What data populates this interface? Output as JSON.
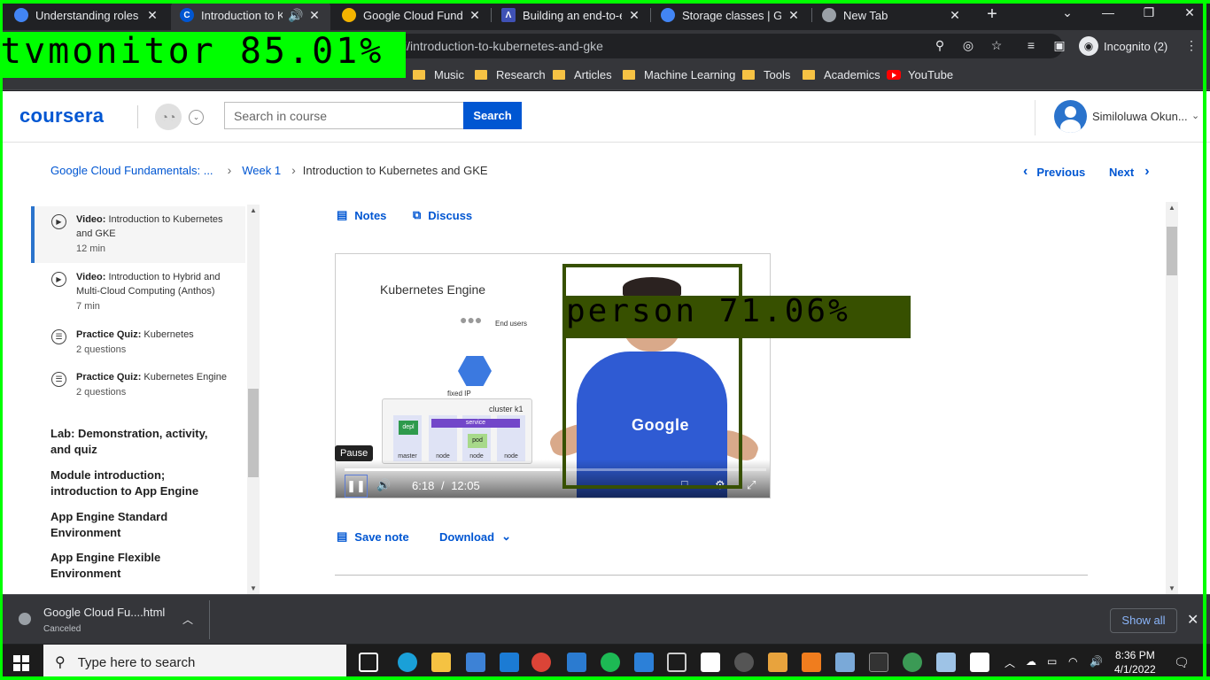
{
  "browser": {
    "tabs": [
      {
        "title": "Understanding roles",
        "favicon_color": "#4285f4",
        "active": false
      },
      {
        "title": "Introduction to Ku",
        "favicon_color": "#0056d2",
        "active": true,
        "audio": true
      },
      {
        "title": "Google Cloud Fundam",
        "favicon_color": "#f4b400",
        "active": false
      },
      {
        "title": "Building an end-to-en",
        "favicon_color": "#3f51b5",
        "active": false
      },
      {
        "title": "Storage classes | Goo",
        "favicon_color": "#4285f4",
        "active": false
      },
      {
        "title": "New Tab",
        "favicon_color": "#9aa0a6",
        "active": false
      }
    ],
    "url": "i/introduction-to-kubernetes-and-gke",
    "profile_label": "Incognito (2)",
    "bookmarks": [
      "Music",
      "Research",
      "Articles",
      "Machine Learning",
      "Tools",
      "Academics",
      "YouTube"
    ]
  },
  "detections": [
    {
      "label": "tvmonitor 85.01%",
      "color": "#00ff00"
    },
    {
      "label": "person 71.06%",
      "color": "#375000"
    }
  ],
  "header": {
    "logo": "coursera",
    "search_placeholder": "Search in course",
    "search_button": "Search",
    "user_name": "Similoluwa Okun..."
  },
  "breadcrumb": {
    "items": [
      "Google Cloud Fundamentals: ...",
      "Week 1"
    ],
    "current": "Introduction to Kubernetes and GKE",
    "previous": "Previous",
    "next": "Next"
  },
  "sidebar": {
    "items": [
      {
        "type": "Video:",
        "title": "Introduction to Kubernetes and GKE",
        "meta": "12 min",
        "active": true
      },
      {
        "type": "Video:",
        "title": "Introduction to Hybrid and Multi-Cloud Computing (Anthos)",
        "meta": "7 min"
      },
      {
        "type": "Practice Quiz:",
        "title": "Kubernetes",
        "meta": "2 questions"
      },
      {
        "type": "Practice Quiz:",
        "title": "Kubernetes Engine",
        "meta": "2 questions"
      }
    ],
    "lessons": [
      "Lab: Demonstration, activity, and quiz",
      "Module introduction; introduction to App Engine",
      "App Engine Standard Environment",
      "App Engine Flexible Environment"
    ]
  },
  "main": {
    "notes": "Notes",
    "discuss": "Discuss",
    "save_note": "Save note",
    "download": "Download"
  },
  "video": {
    "slide_title": "Kubernetes Engine",
    "end_users": "End users",
    "fixed_ip": "fixed IP",
    "cluster": "cluster k1",
    "service": "service",
    "depl": "depl",
    "pod": "pod",
    "nodes": [
      "master",
      "node",
      "node",
      "node"
    ],
    "shirt_text": "Google",
    "current_time": "6:18",
    "duration": "12:05",
    "time_sep": "/",
    "progress": 0.511,
    "tooltip": "Pause"
  },
  "download_bar": {
    "file": "Google Cloud Fu....html",
    "status": "Canceled",
    "show_all": "Show all"
  },
  "taskbar": {
    "search_placeholder": "Type here to search",
    "time": "8:36 PM",
    "date": "4/1/2022"
  }
}
